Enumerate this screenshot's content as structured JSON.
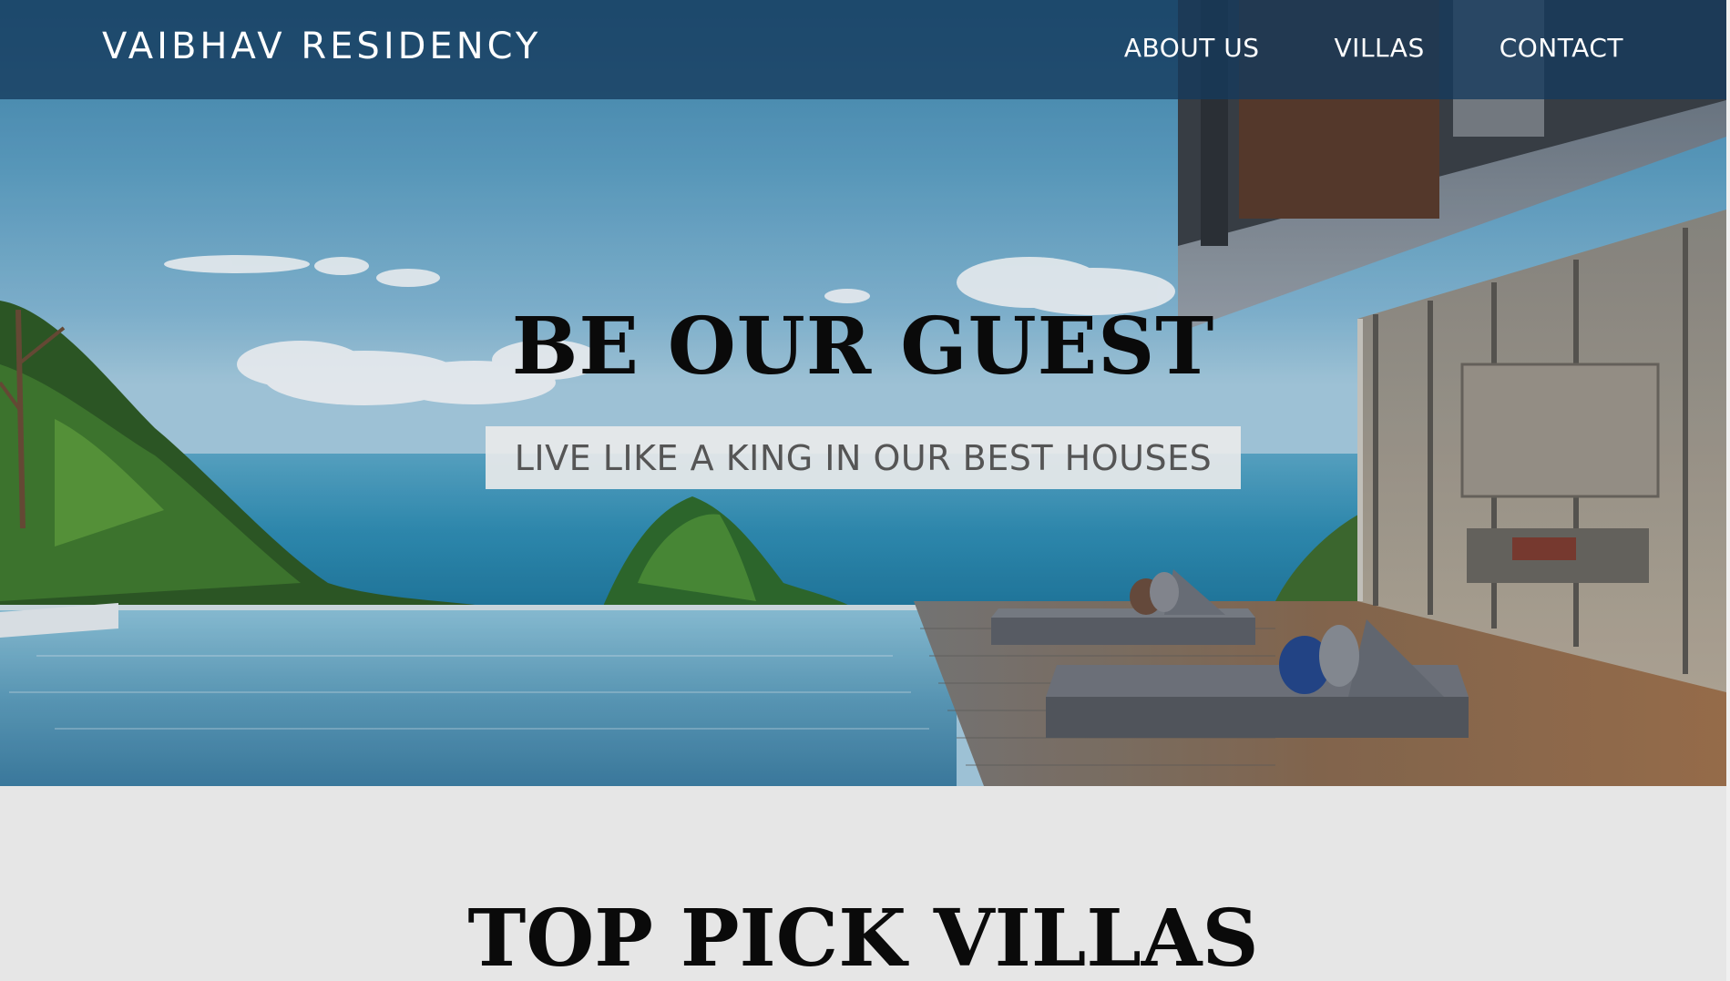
{
  "brand": {
    "name": "VAIBHAV RESIDENCY"
  },
  "nav": {
    "items": [
      "ABOUT US",
      "VILLAS",
      "CONTACT"
    ]
  },
  "hero": {
    "title": "BE OUR GUEST",
    "subtitle": "LIVE LIKE A KING IN OUR BEST HOUSES",
    "image": "villa-infinity-pool-ocean-view"
  },
  "section": {
    "title": "TOP PICK VILLAS"
  },
  "colors": {
    "navbar": "#143a5c",
    "page_background": "#e6e6e6",
    "heading": "#0a0a0a",
    "subtitle_text": "#555555"
  }
}
